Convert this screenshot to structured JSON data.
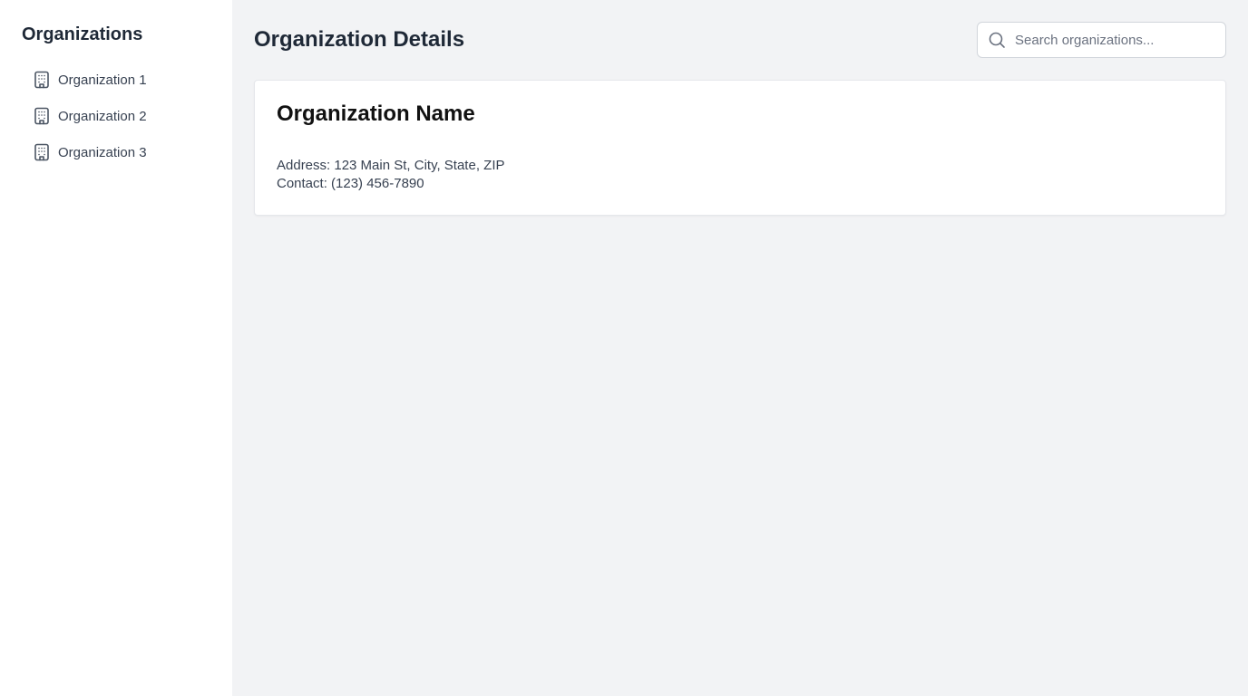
{
  "sidebar": {
    "title": "Organizations",
    "items": [
      {
        "label": "Organization 1",
        "icon": "building-icon"
      },
      {
        "label": "Organization 2",
        "icon": "building-icon"
      },
      {
        "label": "Organization 3",
        "icon": "building-icon"
      }
    ]
  },
  "header": {
    "title": "Organization Details",
    "search": {
      "placeholder": "Search organizations...",
      "value": "",
      "icon": "search-icon"
    }
  },
  "card": {
    "title": "Organization Name",
    "address": "Address: 123 Main St, City, State, ZIP",
    "contact": "Contact: (123) 456-7890"
  },
  "colors": {
    "sidebar_bg": "#ffffff",
    "main_bg": "#f2f3f5",
    "text_primary": "#1f2937",
    "text_secondary": "#374151",
    "border": "#d1d5db"
  }
}
